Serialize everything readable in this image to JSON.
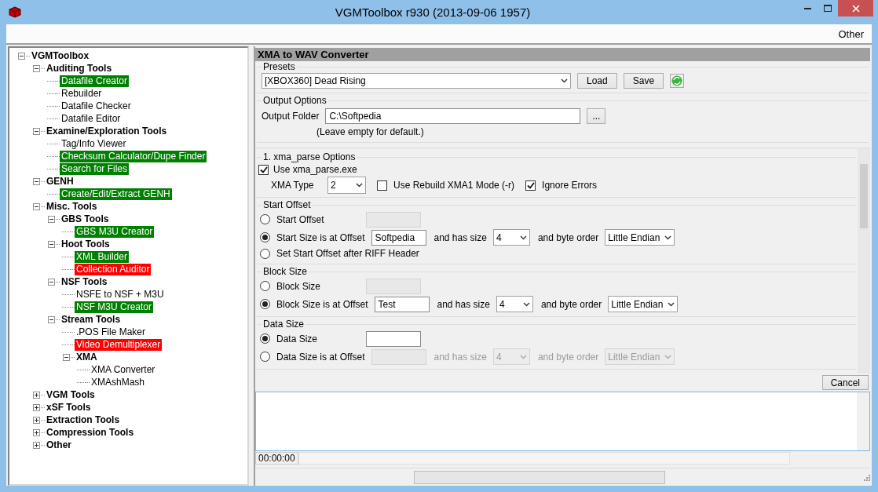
{
  "window": {
    "title": "VGMToolbox r930 (2013-09-06 1957)"
  },
  "menu": [
    "Other"
  ],
  "tree": [
    {
      "label": "VGMToolbox",
      "expanded": true,
      "children": [
        {
          "label": "Auditing Tools",
          "expanded": true,
          "children": [
            {
              "label": "Datafile Creator",
              "color": "#008000"
            },
            {
              "label": "Rebuilder"
            },
            {
              "label": "Datafile Checker"
            },
            {
              "label": "Datafile Editor"
            }
          ]
        },
        {
          "label": "Examine/Exploration Tools",
          "expanded": true,
          "children": [
            {
              "label": "Tag/Info Viewer"
            },
            {
              "label": "Checksum Calculator/Dupe Finder",
              "color": "#008000"
            },
            {
              "label": "Search for Files",
              "color": "#008000"
            }
          ]
        },
        {
          "label": "GENH",
          "expanded": true,
          "children": [
            {
              "label": "Create/Edit/Extract GENH",
              "color": "#008000"
            }
          ]
        },
        {
          "label": "Misc. Tools",
          "expanded": true,
          "children": [
            {
              "label": "GBS Tools",
              "expanded": true,
              "children": [
                {
                  "label": "GBS M3U Creator",
                  "color": "#008000"
                }
              ]
            },
            {
              "label": "Hoot Tools",
              "expanded": true,
              "children": [
                {
                  "label": "XML Builder",
                  "color": "#008000"
                },
                {
                  "label": "Collection Auditor",
                  "color": "#ff0000"
                }
              ]
            },
            {
              "label": "NSF Tools",
              "expanded": true,
              "children": [
                {
                  "label": "NSFE to NSF + M3U"
                },
                {
                  "label": "NSF M3U Creator",
                  "color": "#008000"
                }
              ]
            },
            {
              "label": "Stream Tools",
              "expanded": true,
              "children": [
                {
                  "label": ".POS File Maker"
                },
                {
                  "label": "Video Demultiplexer",
                  "color": "#ff0000"
                },
                {
                  "label": "XMA",
                  "expanded": true,
                  "children": [
                    {
                      "label": "XMA Converter"
                    },
                    {
                      "label": "XMAshMash"
                    }
                  ]
                }
              ]
            }
          ]
        },
        {
          "label": "VGM Tools",
          "expanded": false
        },
        {
          "label": "xSF Tools",
          "expanded": false
        },
        {
          "label": "Extraction Tools",
          "expanded": false
        },
        {
          "label": "Compression Tools",
          "expanded": false
        },
        {
          "label": "Other",
          "expanded": false
        }
      ]
    }
  ],
  "panel": {
    "title": "XMA to WAV Converter",
    "presets": {
      "legend": "Presets",
      "value": "[XBOX360] Dead Rising",
      "buttons": [
        "Load",
        "Save"
      ]
    },
    "output": {
      "legend": "Output Options",
      "label": "Output Folder",
      "value": "C:\\Softpedia",
      "browse": "...",
      "hint": "(Leave empty for default.)"
    },
    "xma_parse": {
      "legend": "1. xma_parse Options",
      "use": {
        "label": "Use xma_parse.exe",
        "checked": true
      },
      "type_label": "XMA Type",
      "type_value": "2",
      "rebuild": {
        "label": "Use Rebuild XMA1 Mode (-r)",
        "checked": false
      },
      "ignore": {
        "label": "Ignore Errors",
        "checked": true
      }
    },
    "sections": [
      {
        "legend": "Start Offset",
        "rows": [
          {
            "label": "Start Offset",
            "selected": false,
            "disabled": true,
            "offset": {}
          },
          {
            "label": "Start Size is at Offset",
            "selected": true,
            "disabled": false,
            "offset": {
              "value": "Softpedia"
            },
            "size": {
              "label": "and has size",
              "value": "4"
            },
            "order": {
              "label": "and byte order",
              "value": "Little Endian"
            }
          },
          {
            "label": "Set Start Offset after RIFF Header",
            "selected": false
          }
        ]
      },
      {
        "legend": "Block Size",
        "rows": [
          {
            "label": "Block Size",
            "selected": false,
            "disabled": true,
            "offset": {}
          },
          {
            "label": "Block Size is at Offset",
            "selected": true,
            "disabled": false,
            "offset": {
              "value": "Test"
            },
            "size": {
              "label": "and has size",
              "value": "4"
            },
            "order": {
              "label": "and byte order",
              "value": "Little Endian"
            }
          }
        ]
      },
      {
        "legend": "Data Size",
        "rows": [
          {
            "label": "Data Size",
            "selected": true,
            "disabled": false,
            "offset": {}
          },
          {
            "label": "Data Size is at Offset",
            "selected": false,
            "disabled": true,
            "offset": {},
            "size": {
              "label": "and has size",
              "value": "4"
            },
            "order": {
              "label": "and byte order",
              "value": "Little Endian"
            }
          }
        ]
      }
    ],
    "cancel": "Cancel",
    "status": {
      "time": "00:00:00"
    },
    "progress": {
      "level": 0
    }
  }
}
